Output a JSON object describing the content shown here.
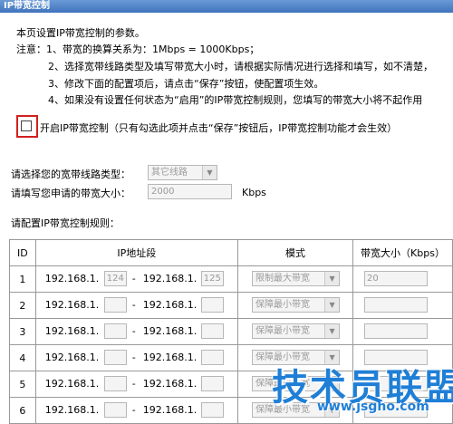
{
  "window": {
    "title": "IP带宽控制"
  },
  "intro": "本页设置IP带宽控制的参数。",
  "notes": [
    "注意：1、带宽的换算关系为：1Mbps = 1000Kbps；",
    "2、选择宽带线路类型及填写带宽大小时，请根据实际情况进行选择和填写，如不清楚，",
    "3、修改下面的配置项后，请点击“保存”按钮，使配置项生效。",
    "4、如果没有设置任何状态为“启用”的IP带宽控制规则，您填写的带宽大小将不起作用"
  ],
  "enable": {
    "label": "开启IP带宽控制（只有勾选此项并点击“保存”按钮后，IP带宽控制功能才会生效）",
    "checked": false
  },
  "line_type": {
    "label": "请选择您的宽带线路类型：",
    "value": "其它线路"
  },
  "bandwidth": {
    "label": "请填写您申请的带宽大小：",
    "value": "2000",
    "unit": "Kbps"
  },
  "rules_title": "请配置IP带宽控制规则：",
  "table": {
    "headers": {
      "id": "ID",
      "ip": "IP地址段",
      "mode": "模式",
      "bw": "带宽大小（Kbps）"
    },
    "prefix": "192.168.1.",
    "dash": "-",
    "rows": [
      {
        "id": "1",
        "start": "124",
        "end": "125",
        "mode": "限制最大带宽",
        "bw": "20"
      },
      {
        "id": "2",
        "start": "",
        "end": "",
        "mode": "保障最小带宽",
        "bw": ""
      },
      {
        "id": "3",
        "start": "",
        "end": "",
        "mode": "保障最小带宽",
        "bw": ""
      },
      {
        "id": "4",
        "start": "",
        "end": "",
        "mode": "保障最小带宽",
        "bw": ""
      },
      {
        "id": "5",
        "start": "",
        "end": "",
        "mode": "保障最小带宽",
        "bw": ""
      },
      {
        "id": "6",
        "start": "",
        "end": "",
        "mode": "保障最小带宽",
        "bw": ""
      }
    ]
  },
  "watermark": {
    "title": "技术员联盟",
    "url": "www.jsgho.com"
  }
}
